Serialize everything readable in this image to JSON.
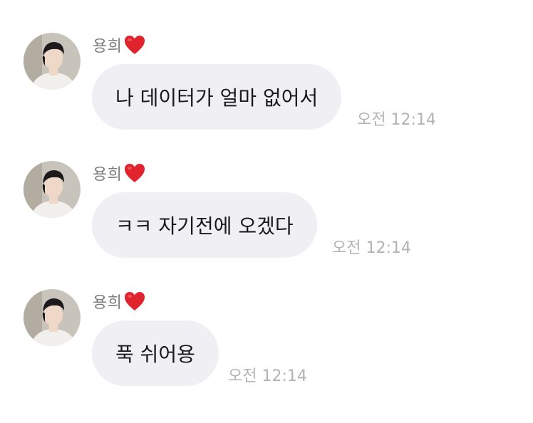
{
  "messages": [
    {
      "sender": "용희",
      "text": "나 데이터가 얼마 없어서",
      "time": "오전 12:14"
    },
    {
      "sender": "용희",
      "text": "ㅋㅋ 자기전에 오겠다",
      "time": "오전 12:14"
    },
    {
      "sender": "용희",
      "text": "푹 쉬어용",
      "time": "오전 12:14"
    }
  ],
  "icons": {
    "heart": "heart-emoji",
    "avatar": "profile-photo"
  },
  "colors": {
    "bubble": "#efeff4",
    "sender_name": "#7d7d82",
    "timestamp": "#b2b2b8",
    "heart": "#e0242e"
  }
}
